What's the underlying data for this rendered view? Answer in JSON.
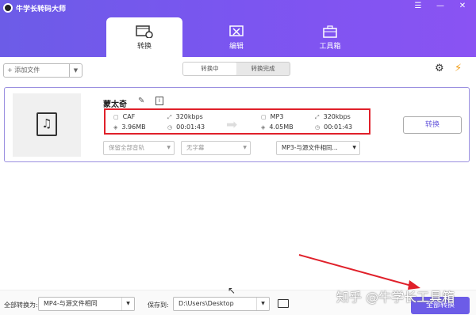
{
  "app": {
    "title": "牛学长转码大师"
  },
  "window_controls": {
    "menu": "☰",
    "minimize": "—",
    "close": "✕"
  },
  "tabs": [
    {
      "label": "转换",
      "active": true
    },
    {
      "label": "编辑",
      "active": false
    },
    {
      "label": "工具箱",
      "active": false
    }
  ],
  "toolbar": {
    "add_file": "+ 添加文件",
    "segment": [
      "转换中",
      "转换完成"
    ]
  },
  "file": {
    "name": "蒙太奇",
    "source": {
      "format": "CAF",
      "bitrate": "320kbps",
      "size": "3.96MB",
      "duration": "00:01:43"
    },
    "target": {
      "format": "MP3",
      "bitrate": "320kbps",
      "size": "4.05MB",
      "duration": "00:01:43"
    },
    "audio_track": "保留全部音轨",
    "subtitle": "无字幕",
    "output_format": "MP3-与源文件相同...",
    "convert_button": "转换"
  },
  "bottom": {
    "convert_all_label": "全部转换为:",
    "convert_all_value": "MP4-与源文件相同",
    "save_to_label": "保存到:",
    "save_to_value": "D:\\Users\\Desktop",
    "convert_all_button": "全部转换"
  },
  "watermark": "知乎 @牛学长工具箱",
  "colors": {
    "accent": "#6c5ce7",
    "highlight": "#e0202a"
  }
}
